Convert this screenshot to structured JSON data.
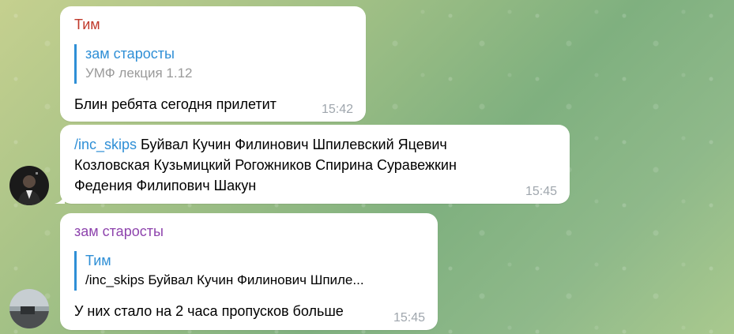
{
  "messages": [
    {
      "sender": "Тим",
      "sender_color": "#c0392b",
      "reply_to": {
        "name": "зам старосты",
        "text": "УМФ лекция 1.12"
      },
      "text": "Блин ребята сегодня прилетит",
      "time": "15:42"
    },
    {
      "command": "/inc_skips",
      "text_line1": " Буйвал Кучин Филинович Шпилевский Яцевич",
      "text_line2": "Козловская Кузьмицкий Рогожников Спирина Суравежкин",
      "text_line3": "Федения Филипович Шакун",
      "time": "15:45"
    },
    {
      "sender": "зам старосты",
      "sender_color": "#8e44ad",
      "reply_to": {
        "name": "Тим",
        "text": "/inc_skips Буйвал Кучин Филинович Шпиле..."
      },
      "text": "У них стало на 2 часа пропусков больше",
      "time": "15:45"
    }
  ],
  "colors": {
    "link": "#2f8fd6",
    "time": "#9fa6ad",
    "bubble": "#ffffff"
  }
}
